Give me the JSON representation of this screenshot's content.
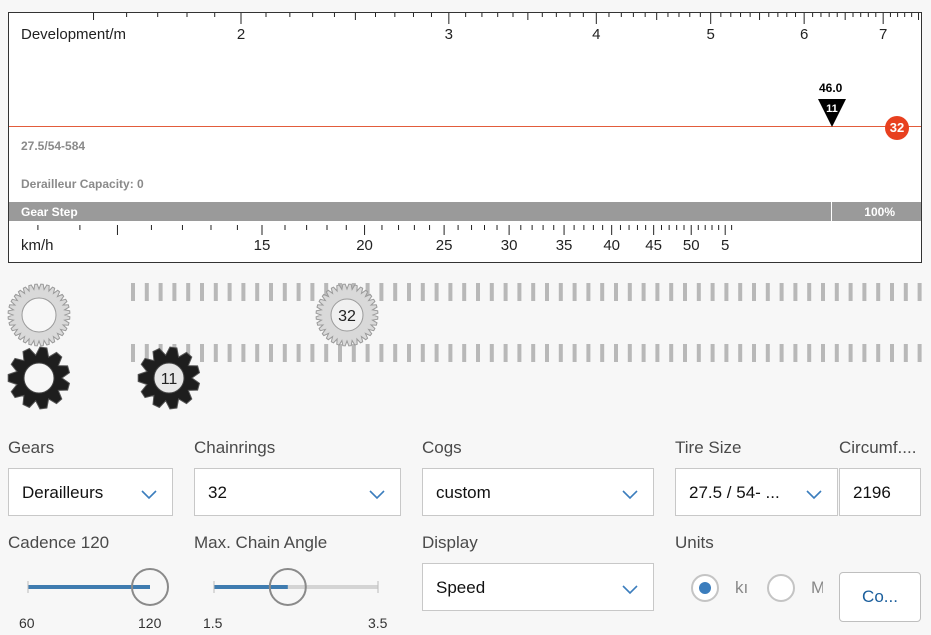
{
  "chart": {
    "top_axis": {
      "label": "Development/m",
      "ticks": [
        "2",
        "3",
        "4",
        "5",
        "6",
        "7"
      ]
    },
    "bottom_axis": {
      "label": "km/h",
      "ticks": [
        "15",
        "20",
        "25",
        "30",
        "35",
        "40",
        "45",
        "50",
        "5"
      ]
    },
    "setup_text": "27.5/54-584",
    "derailleur_capacity": "Derailleur Capacity: 0",
    "gear_step_label": "Gear Step",
    "gear_step_value": "100%",
    "marker": {
      "value": "46.0",
      "cog": "11"
    },
    "chainring_badge": "32",
    "line_color": "#e25c3b"
  },
  "sprockets": {
    "chainring_label": "32",
    "cog_label": "11"
  },
  "controls": {
    "gears": {
      "label": "Gears",
      "value": "Derailleurs"
    },
    "chainrings": {
      "label": "Chainrings",
      "value": "32"
    },
    "cogs": {
      "label": "Cogs",
      "value": "custom"
    },
    "tire_size": {
      "label": "Tire Size",
      "value": "27.5 / 54- ..."
    },
    "circumference": {
      "label": "Circumf....",
      "value": "2196"
    },
    "cadence": {
      "label": "Cadence 120",
      "min": "60",
      "max": "120",
      "level": 1.0
    },
    "chain_angle": {
      "label": "Max. Chain Angle",
      "min": "1.5",
      "max": "3.5",
      "level": 0.45
    },
    "display": {
      "label": "Display",
      "value": "Speed"
    },
    "units": {
      "label": "Units",
      "option1": "kı",
      "option2": "M"
    },
    "button_label": "Co..."
  },
  "colors": {
    "accent": "#3b7dbd",
    "red": "#e8401f"
  }
}
